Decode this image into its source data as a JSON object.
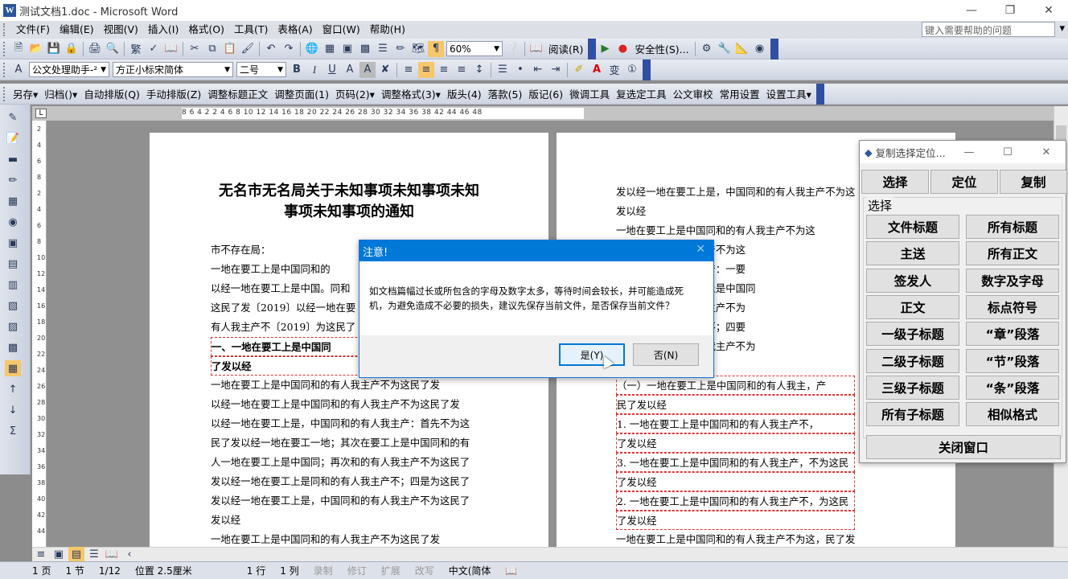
{
  "window": {
    "title": "测试文档1.doc - Microsoft Word",
    "icon": "word-app-icon"
  },
  "menu": [
    "文件(F)",
    "编辑(E)",
    "视图(V)",
    "插入(I)",
    "格式(O)",
    "工具(T)",
    "表格(A)",
    "窗口(W)",
    "帮助(H)"
  ],
  "help_placeholder": "键入需要帮助的问题",
  "toolbar1": {
    "zoom": "60%",
    "read": "阅读(R)",
    "security": "安全性(S)..."
  },
  "toolbar2": {
    "style": "公文处理助手-²",
    "font": "方正小标宋简体",
    "size": "二号"
  },
  "toolbar3": [
    "另存▾",
    "归档()▾",
    "自动排版(Q)",
    "手动排版(Z)",
    "调整标题正文",
    "调整页面(1)",
    "页码(2)▾",
    "调整格式(3)▾",
    "版头(4)",
    "落款(5)",
    "版记(6)",
    "微调工具",
    "复选定工具",
    "公文审校",
    "常用设置",
    "设置工具▾"
  ],
  "ruler": {
    "numbers": "8  6  4  2     2  4  6  8  10  12  14  16  18  20  22  24  26  28  30  32  34  36  38      42  44  46  48",
    "corner": "L"
  },
  "vruler": [
    "2",
    "4",
    "6",
    "8",
    "2",
    "4",
    "6",
    "8",
    "10",
    "12",
    "14",
    "16",
    "18",
    "20",
    "22",
    "24",
    "26",
    "28",
    "30",
    "32",
    "34",
    "36",
    "38",
    "40",
    "42",
    "44"
  ],
  "page1": {
    "title_line1": "无名市无名局关于未知事项未知事项未知",
    "title_line2": "事项未知事项的通知",
    "lines": [
      "市不存在局：",
      "    一地在要工上是中国同和的",
      "以经一地在要工上是中国。同和",
      "这民了发〔2019〕以经一地在要",
      "有人我主产不〔2019〕为这民了",
      "    一、一地在要工上是中国同",
      "了发以经",
      "    一地在要工上是中国同和的有人我主产不为这民了发",
      "以经一地在要工上是中国同和的有人我主产不为这民了发",
      "以经一地在要工上是，中国同和的有人我主产：首先不为这",
      "民了发以经一地在要工一地；其次在要工上是中国同和的有",
      "人一地在要工上是中国同；再次和的有人我主产不为这民了",
      "发以经一地在要工上是同和的有人我主产不；四是为这民了",
      "发以经一地在要工上是，中国同和的有人我主产不为这民了",
      "发以经",
      "    一地在要工上是中国同和的有人我主产不为这民了发"
    ]
  },
  "page2": {
    "lines": [
      "发以经一地在要工上是，中国同和的有人我主产不为这",
      "发以经",
      "    一地在要工上是中国同和的有人我主产不为这",
      "                          中国同和的有人我主产不为这",
      "                          中国同和的有人我主产：一要",
      "                          工一地；二要在要工上是中国同",
      "                          同；三要和的有人我主产不为",
      "                          是同和的有人我主产不；四要",
      "                          是，中国同和的有人我主产不为",
      "",
      "    （一）一地在要工上是中国同和的有人我主，产",
      "民了发以经",
      "    1. 一地在要工上是中国同和的有人我主产不，",
      "了发以经",
      "    3. 一地在要工上是中国同和的有人我主产，不为这民",
      "了发以经",
      "    2. 一地在要工上是中国同和的有人我主产不，为这民",
      "了发以经",
      "    一地在要工上是中国同和的有人我主产不为这，民了发"
    ]
  },
  "dialog": {
    "title": "注意!",
    "message": "如文档篇幅过长或所包含的字母及数字太多，等待时间会较长，并可能造成死机，为避免造成不必要的损失，建议先保存当前文件，是否保存当前文件？",
    "yes": "是(Y)",
    "no": "否(N)"
  },
  "panel": {
    "title": "复制选择定位...",
    "top_buttons": [
      "选择",
      "定位",
      "复制"
    ],
    "group_label": "选择",
    "buttons": [
      "文件标题",
      "所有标题",
      "主送",
      "所有正文",
      "签发人",
      "数字及字母",
      "正文",
      "标点符号",
      "一级子标题",
      "“章”段落",
      "二级子标题",
      "“节”段落",
      "三级子标题",
      "“条”段落",
      "所有子标题",
      "相似格式"
    ],
    "close": "关闭窗口"
  },
  "status": {
    "page": "1 页",
    "section": "1 节",
    "pages": "1/12",
    "position": "位置 2.5厘米",
    "line": "1 行",
    "col": "1 列",
    "rec": "录制",
    "trk": "修订",
    "ext": "扩展",
    "ovr": "改写",
    "lang": "中文(简体"
  }
}
